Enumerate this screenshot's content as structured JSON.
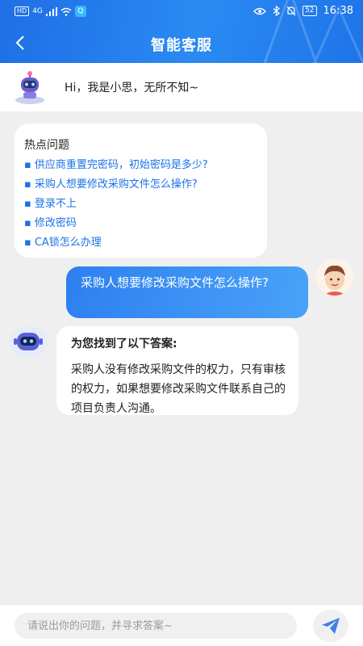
{
  "statusbar": {
    "network_badge": "HD",
    "network_type": "4G",
    "app_badge": "Q",
    "battery": "52",
    "time": "16:38"
  },
  "header": {
    "title": "智能客服"
  },
  "greeting": {
    "text": "Hi，我是小思，无所不知~"
  },
  "hot_questions": {
    "title": "热点问题",
    "items": [
      "供应商重置完密码，初始密码是多少?",
      "采购人想要修改采购文件怎么操作?",
      "登录不上",
      "修改密码",
      "CA锁怎么办理"
    ]
  },
  "user_message": {
    "text": "采购人想要修改采购文件怎么操作?"
  },
  "bot_answer": {
    "title": "为您找到了以下答案:",
    "body": "采购人没有修改采购文件的权力，只有审核的权力，如果想要修改采购文件联系自己的项目负责人沟通。"
  },
  "input": {
    "placeholder": "请说出你的问题，并寻求答案~"
  },
  "colors": {
    "header_blue": "#1f6fe6",
    "link_blue": "#1a73e8",
    "bubble_blue": "#2d80f0",
    "background": "#efefef"
  }
}
